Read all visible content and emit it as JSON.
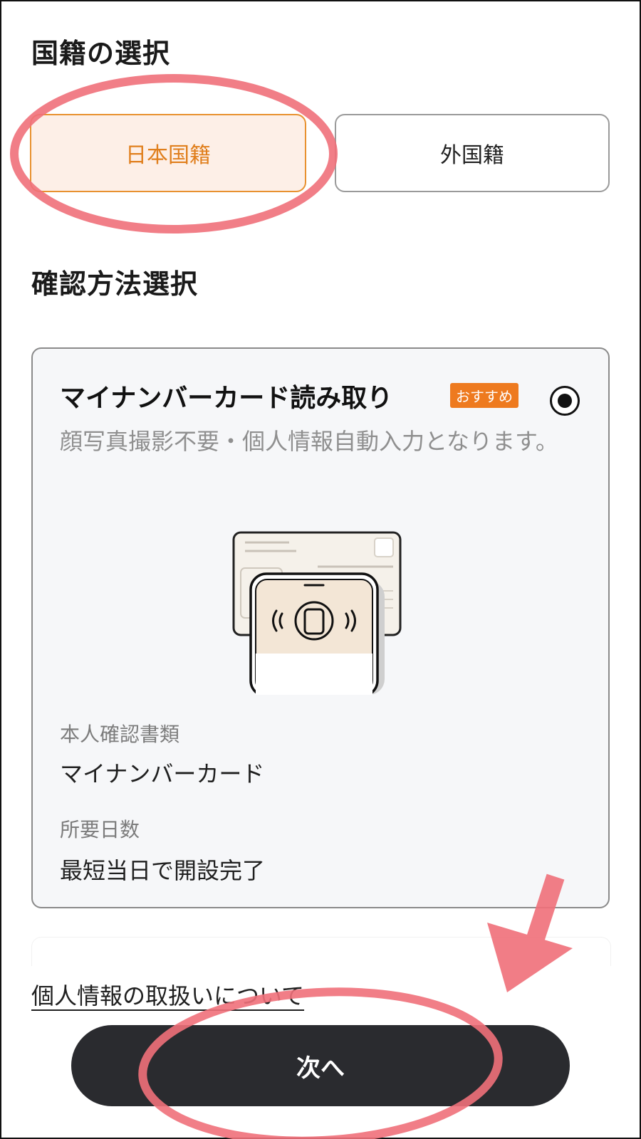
{
  "nationality": {
    "title": "国籍の選択",
    "options": [
      {
        "label": "日本国籍",
        "selected": true
      },
      {
        "label": "外国籍",
        "selected": false
      }
    ]
  },
  "method": {
    "title": "確認方法選択",
    "card": {
      "title": "マイナンバーカード読み取り",
      "badge": "おすすめ",
      "description": "顔写真撮影不要・個人情報自動入力となります。",
      "doc_label": "本人確認書類",
      "doc_value": "マイナンバーカード",
      "days_label": "所要日数",
      "days_value": "最短当日で開設完了"
    }
  },
  "privacy_link": "個人情報の取扱いについて",
  "next_button": "次へ",
  "colors": {
    "accent": "#ee7a1f",
    "selected_bg": "#fdefe7",
    "annotation": "#f0707a",
    "button_dark": "#2a2b2f"
  }
}
